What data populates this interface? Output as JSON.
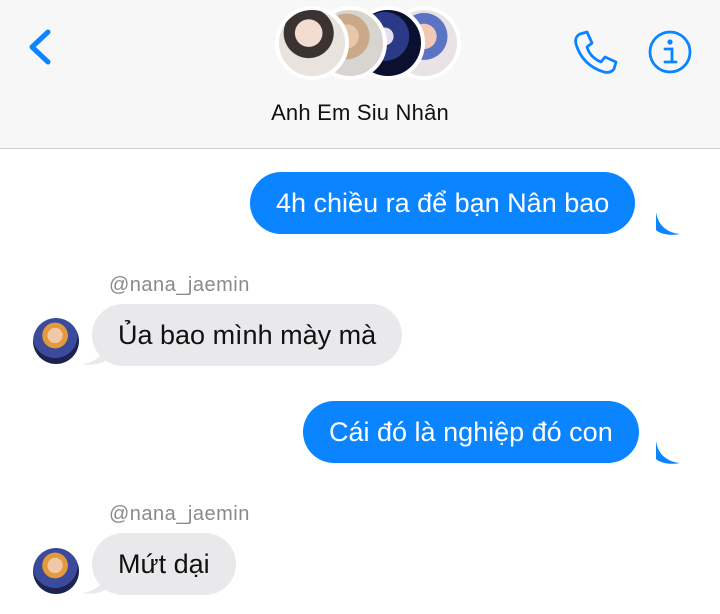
{
  "header": {
    "title": "Anh Em Siu Nhân",
    "icons": {
      "back": "chevron-left-icon",
      "call": "phone-icon",
      "info": "info-icon"
    },
    "accent_color": "#0a84ff"
  },
  "messages": [
    {
      "direction": "outgoing",
      "text": "4h chiều ra để bạn Nân bao"
    },
    {
      "direction": "incoming",
      "sender": "@nana_jaemin",
      "text": "Ủa bao mình mày mà"
    },
    {
      "direction": "outgoing",
      "text": "Cái đó là nghiệp đó con"
    },
    {
      "direction": "incoming",
      "sender": "@nana_jaemin",
      "text": "Mứt dại"
    }
  ],
  "colors": {
    "outgoing_bubble": "#0a84ff",
    "incoming_bubble": "#e9e9eb",
    "sender_text": "#8a8a8e"
  }
}
